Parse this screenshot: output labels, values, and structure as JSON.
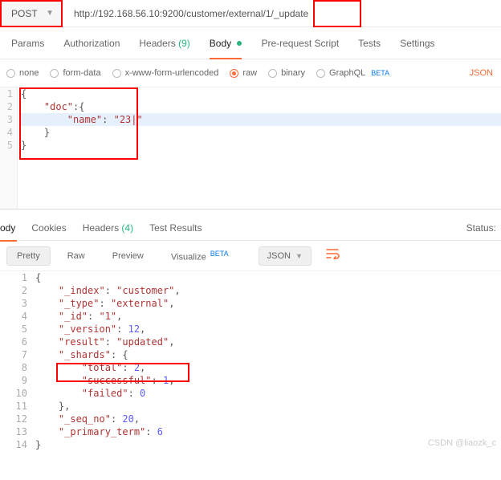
{
  "request": {
    "method": "POST",
    "url": "http://192.168.56.10:9200/customer/external/1/_update",
    "tabs": {
      "params": "Params",
      "auth": "Authorization",
      "headers": "Headers",
      "headers_count": "(9)",
      "body": "Body",
      "prereq": "Pre-request Script",
      "tests": "Tests",
      "settings": "Settings"
    },
    "body_types": {
      "none": "none",
      "formdata": "form-data",
      "xwww": "x-www-form-urlencoded",
      "raw": "raw",
      "binary": "binary",
      "graphql": "GraphQL",
      "beta": "BETA"
    },
    "body_lang": "JSON",
    "body_lines": [
      {
        "n": 1,
        "text": "{"
      },
      {
        "n": 2,
        "text": "    \"doc\":{"
      },
      {
        "n": 3,
        "text": "        \"name\":\"23\"",
        "hl": true
      },
      {
        "n": 4,
        "text": "    }"
      },
      {
        "n": 5,
        "text": "}"
      }
    ]
  },
  "response": {
    "tabs": {
      "body": "ody",
      "cookies": "Cookies",
      "headers": "Headers",
      "headers_count": "(4)",
      "tests": "Test Results"
    },
    "status_label": "Status:",
    "view": {
      "pretty": "Pretty",
      "raw": "Raw",
      "preview": "Preview",
      "visualize": "Visualize",
      "beta": "BETA",
      "lang": "JSON"
    },
    "lines": [
      {
        "n": 1,
        "raw": "{"
      },
      {
        "n": 2,
        "raw": "    \"_index\": \"customer\","
      },
      {
        "n": 3,
        "raw": "    \"_type\": \"external\","
      },
      {
        "n": 4,
        "raw": "    \"_id\": \"1\","
      },
      {
        "n": 5,
        "raw": "    \"_version\": 12,"
      },
      {
        "n": 6,
        "raw": "    \"result\": \"updated\","
      },
      {
        "n": 7,
        "raw": "    \"_shards\": {"
      },
      {
        "n": 8,
        "raw": "        \"total\": 2,"
      },
      {
        "n": 9,
        "raw": "        \"successful\": 1,"
      },
      {
        "n": 10,
        "raw": "        \"failed\": 0"
      },
      {
        "n": 11,
        "raw": "    },"
      },
      {
        "n": 12,
        "raw": "    \"_seq_no\": 20,"
      },
      {
        "n": 13,
        "raw": "    \"_primary_term\": 6"
      },
      {
        "n": 14,
        "raw": "}"
      }
    ],
    "data": {
      "_index": "customer",
      "_type": "external",
      "_id": "1",
      "_version": 12,
      "result": "updated",
      "_shards": {
        "total": 2,
        "successful": 1,
        "failed": 0
      },
      "_seq_no": 20,
      "_primary_term": 6
    }
  },
  "watermark": "CSDN @liaozk_c"
}
